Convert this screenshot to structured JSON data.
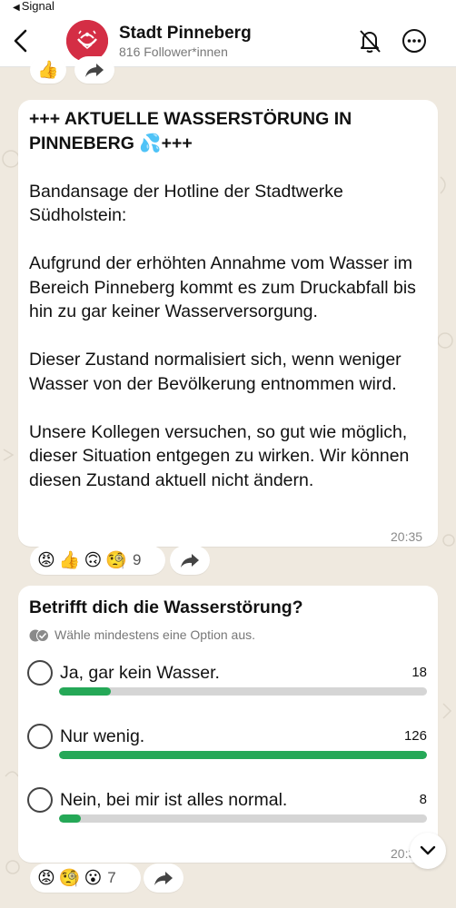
{
  "status_bar": {
    "back_app": "Signal"
  },
  "header": {
    "title": "Stadt Pinneberg",
    "subtitle": "816 Follower*innen"
  },
  "top_reactions": {
    "emojis": [
      "thumbs-up"
    ]
  },
  "message": {
    "headline": "+++ AKTUELLE WASSERSTÖRUNG IN PINNEBERG 💦+++",
    "body": "Bandansage der Hotline der Stadtwerke Südholstein:\n\nAufgrund der erhöhten Annahme vom Wasser im Bereich Pinneberg kommt es zum Druckabfall bis hin zu gar keiner Wasserversorgung.\n\nDieser Zustand normalisiert sich, wenn weniger Wasser von der Bevölkerung entnommen wird.\n\nUnsere Kollegen versuchen, so gut wie möglich, dieser Situation entgegen zu wirken. Wir können diesen Zustand aktuell nicht ändern.",
    "time": "20:35",
    "reactions": {
      "emojis": [
        "angry-face",
        "thumbs-up",
        "upside-down-face",
        "monocle-face"
      ],
      "count": "9"
    }
  },
  "poll": {
    "question": "Betrifft dich die Wasserstörung?",
    "hint": "Wähle mindestens eine Option aus.",
    "options": [
      {
        "label": "Ja, gar kein Wasser.",
        "count": "18",
        "fraction": 0.14
      },
      {
        "label": "Nur wenig.",
        "count": "126",
        "fraction": 1.0
      },
      {
        "label": "Nein, bei mir ist alles normal.",
        "count": "8",
        "fraction": 0.06
      }
    ],
    "time": "20:3",
    "reactions": {
      "emojis": [
        "angry-face",
        "monocle-face",
        "astonished-face"
      ],
      "count": "7"
    }
  },
  "colors": {
    "accent_green": "#25a857",
    "avatar_red": "#d42e45",
    "background": "#efe9df"
  }
}
